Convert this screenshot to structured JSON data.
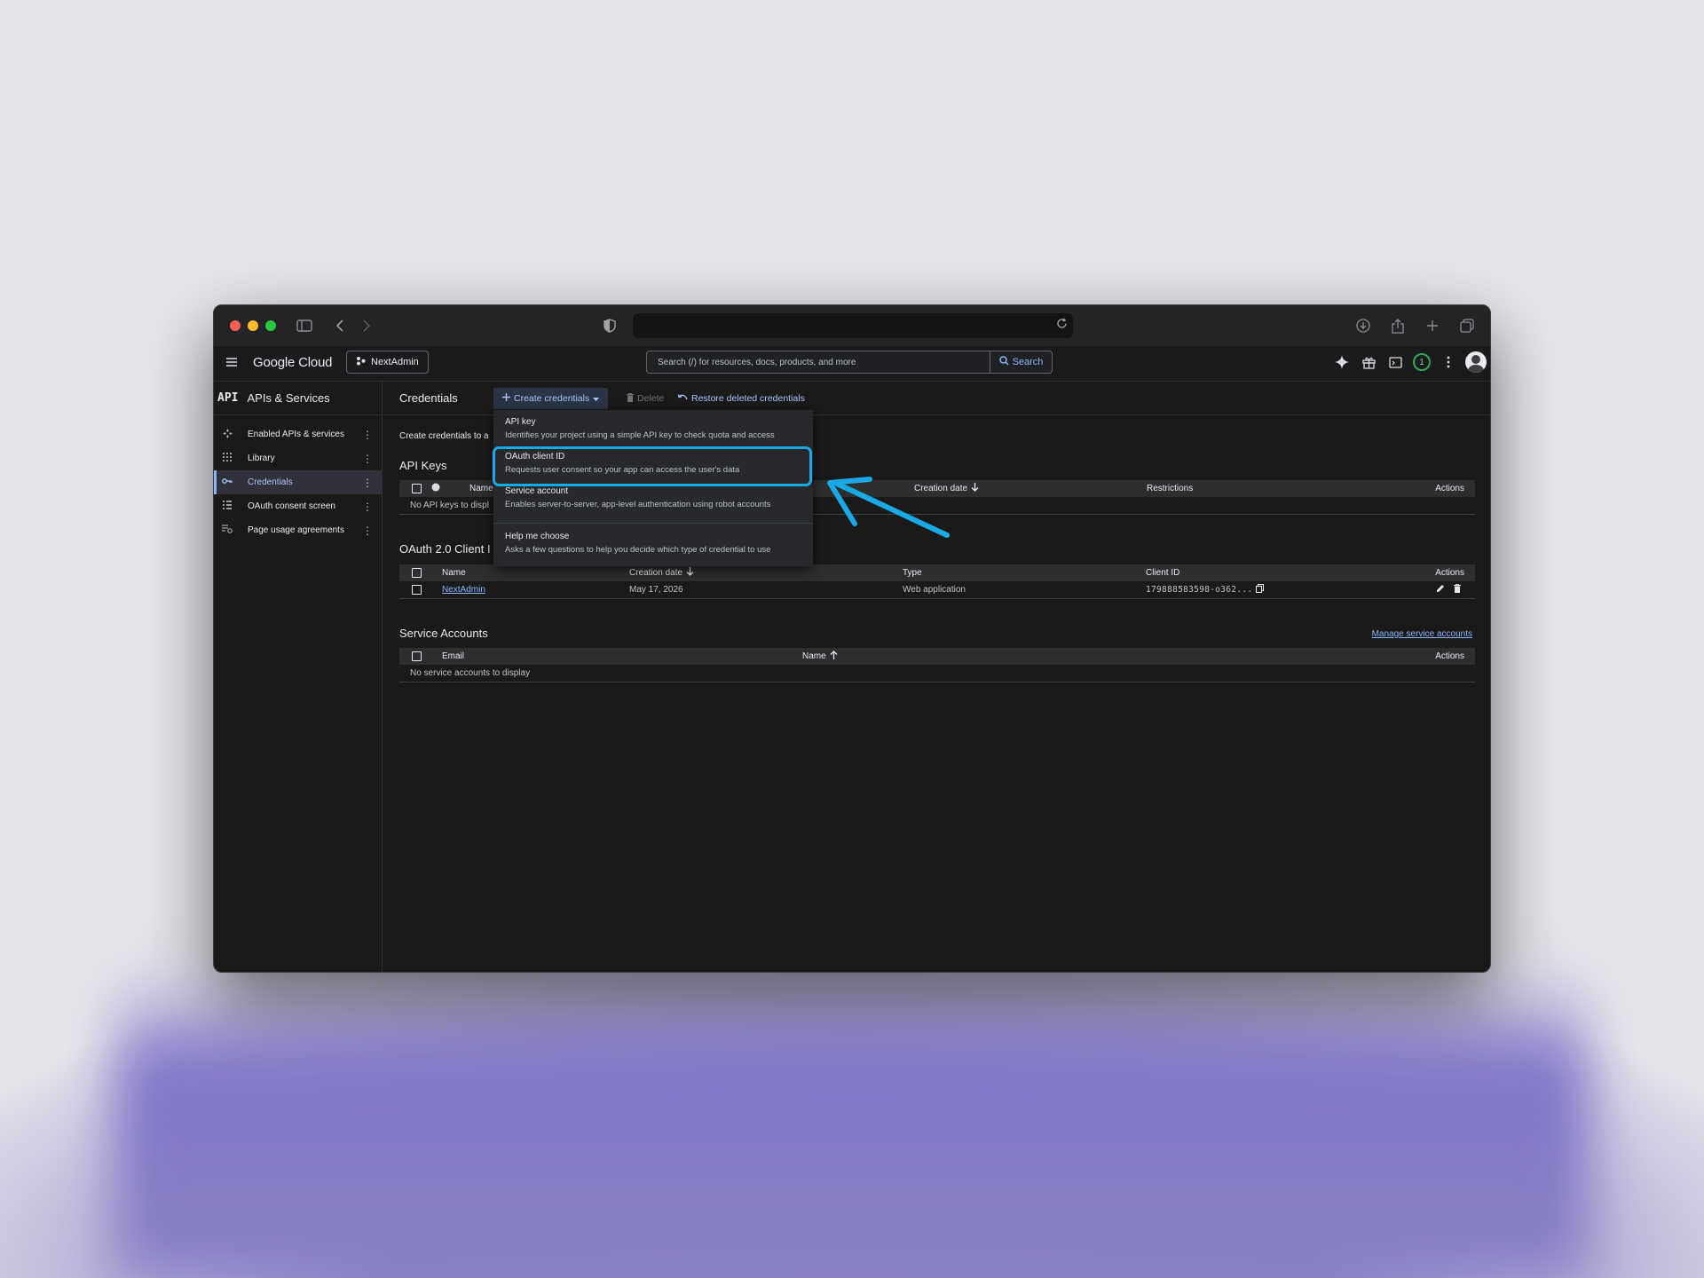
{
  "browser": {
    "url": ""
  },
  "gcp": {
    "brand": "Google Cloud",
    "project": "NextAdmin",
    "search_placeholder": "Search (/) for resources, docs, products, and more",
    "search_button": "Search",
    "notification_count": "1"
  },
  "sidebar": {
    "logo": "API",
    "title": "APIs & Services",
    "items": [
      {
        "label": "Enabled APIs & services",
        "icon": "enabled-apis-icon"
      },
      {
        "label": "Library",
        "icon": "library-icon"
      },
      {
        "label": "Credentials",
        "icon": "key-icon",
        "active": true
      },
      {
        "label": "OAuth consent screen",
        "icon": "oauth-icon"
      },
      {
        "label": "Page usage agreements",
        "icon": "agreements-icon"
      }
    ]
  },
  "actionbar": {
    "title": "Credentials",
    "create": "Create credentials",
    "delete": "Delete",
    "restore": "Restore deleted credentials"
  },
  "intro_text": "Create credentials to a",
  "api_keys": {
    "title": "API Keys",
    "columns": [
      "Name",
      "Creation date",
      "Restrictions",
      "Actions"
    ],
    "empty": "No API keys to displ"
  },
  "oauth": {
    "title": "OAuth 2.0 Client I",
    "columns": [
      "Name",
      "Creation date",
      "Type",
      "Client ID",
      "Actions"
    ],
    "rows": [
      {
        "name": "NextAdmin",
        "date": "May 17, 2026",
        "type": "Web application",
        "client_id": "179888583598-o362..."
      }
    ]
  },
  "service_accounts": {
    "title": "Service Accounts",
    "manage": "Manage service accounts",
    "columns": [
      "Email",
      "Name",
      "Actions"
    ],
    "empty": "No service accounts to display"
  },
  "menu": {
    "items": [
      {
        "title": "API key",
        "desc": "Identifies your project using a simple API key to check quota and access"
      },
      {
        "title": "OAuth client ID",
        "desc": "Requests user consent so your app can access the user's data"
      },
      {
        "title": "Service account",
        "desc": "Enables server-to-server, app-level authentication using robot accounts"
      },
      {
        "title": "Help me choose",
        "desc": "Asks a few questions to help you decide which type of credential to use"
      }
    ]
  },
  "colors": {
    "accent": "#8ab4f8",
    "annotation": "#19a9e5",
    "background": "#1a1a1b"
  }
}
